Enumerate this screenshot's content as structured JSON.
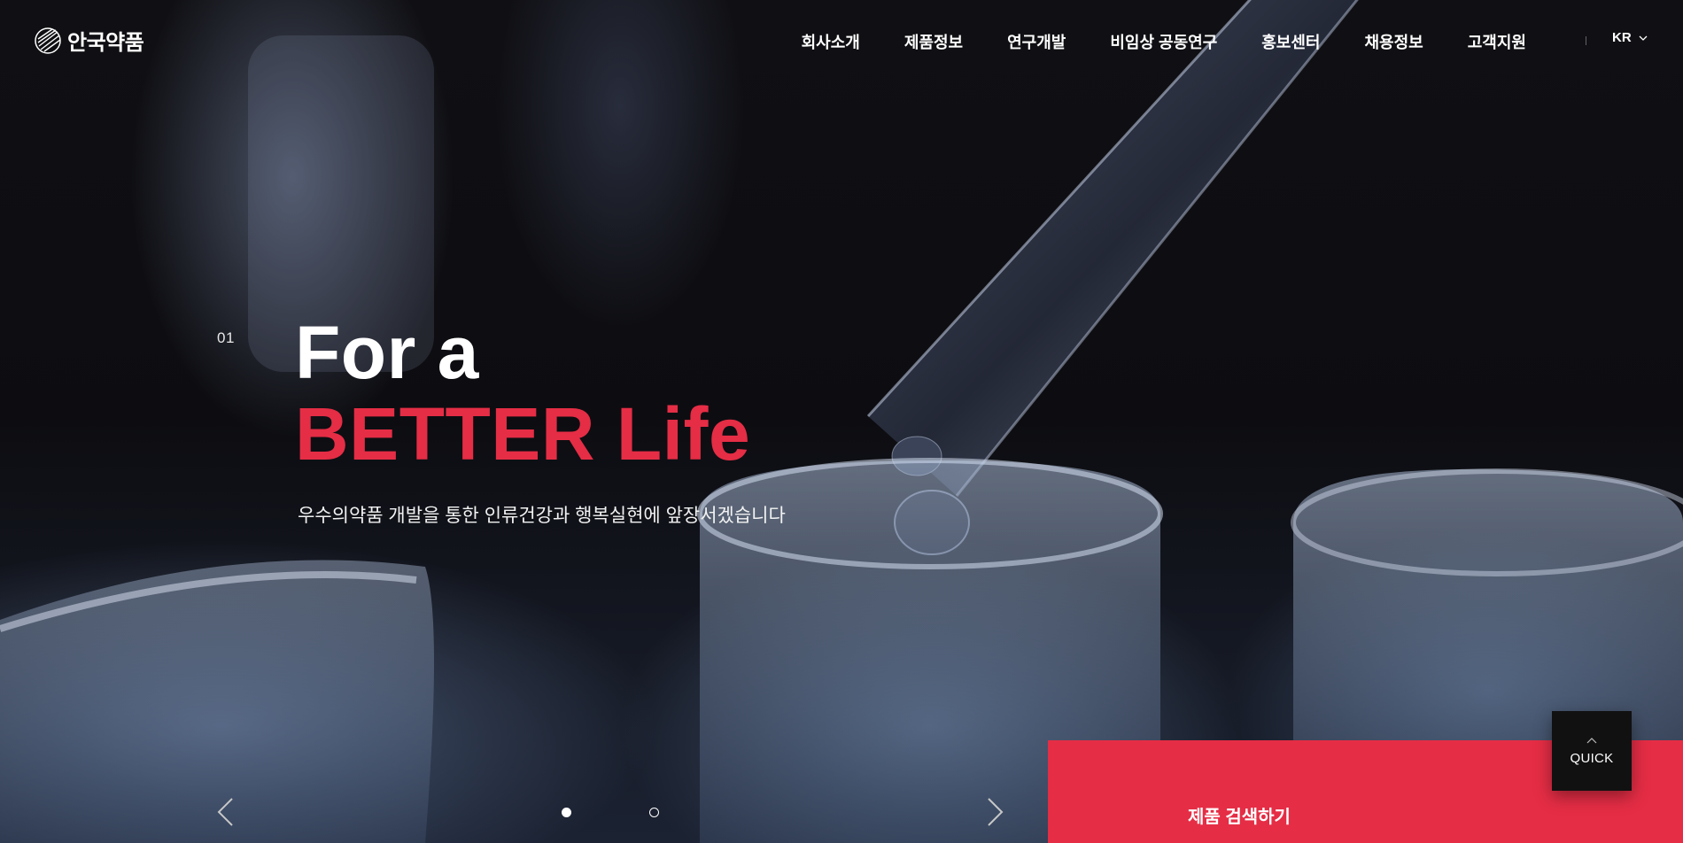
{
  "brand": {
    "logo_text": "안국약품",
    "logo_icon": "sunburst-logo-icon"
  },
  "nav": {
    "items": [
      {
        "label": "회사소개"
      },
      {
        "label": "제품정보"
      },
      {
        "label": "연구개발"
      },
      {
        "label": "비임상 공동연구"
      },
      {
        "label": "홍보센터"
      },
      {
        "label": "채용정보"
      },
      {
        "label": "고객지원"
      }
    ],
    "language": {
      "label": "KR",
      "icon": "chevron-down-icon"
    }
  },
  "hero": {
    "slide_number": "01",
    "headline_line1": "For a",
    "headline_line2": "BETTER Life",
    "subcopy": "우수의약품 개발을 통한 인류건강과 행복실현에 앞장서겠습니다",
    "slides_total": 2,
    "active_slide": 1,
    "prev_icon": "chevron-left-icon",
    "next_icon": "chevron-right-icon"
  },
  "search": {
    "label": "제품 검색하기"
  },
  "quick": {
    "label": "QUICK",
    "icon": "chevron-up-icon"
  },
  "colors": {
    "accent": "#e52d45",
    "background": "#0b0b0d",
    "text": "#ffffff",
    "quick_bg": "#111111"
  }
}
